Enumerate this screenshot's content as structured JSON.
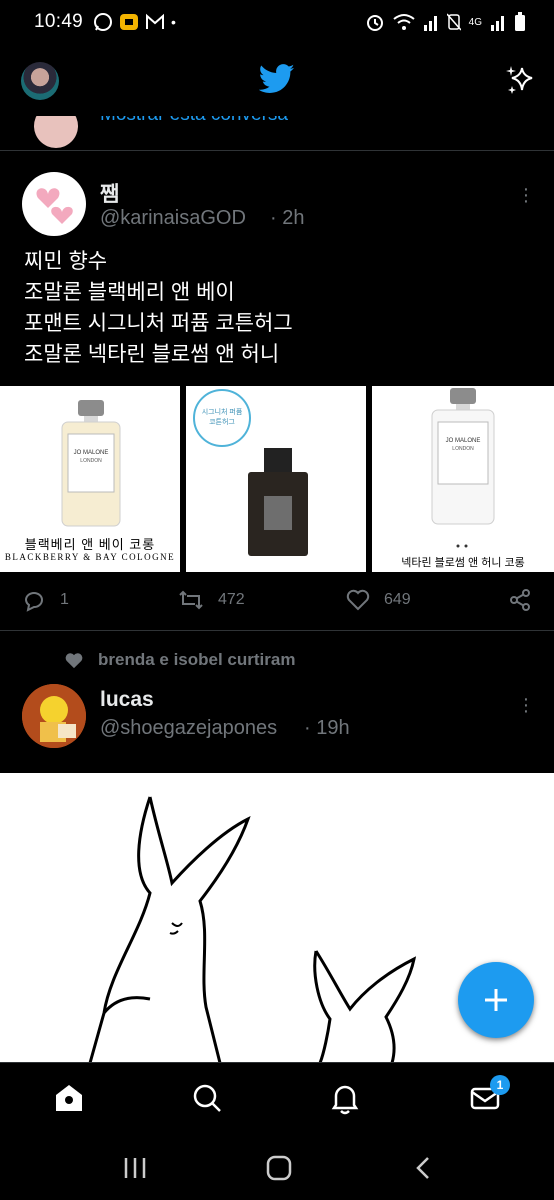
{
  "status_bar": {
    "time": "10:49",
    "network": "4G"
  },
  "header": {
    "logo_icon": "twitter-bird-icon",
    "sparkle_icon": "sparkle-icon"
  },
  "previous_tweet": {
    "link_text": "Mostrar esta conversa"
  },
  "tweet1": {
    "name": "쨈",
    "handle": "@karinaisaGOD",
    "time": "· 2h",
    "text": "찌민 향수\n조말론 블랙베리 앤 베이\n포맨트 시그니처 퍼퓸 코튼허그\n조말론 넥타린 블로썸 앤 허니",
    "images": [
      {
        "caption_ko": "블랙베리 앤 베이 코롱",
        "caption_en": "BLACKBERRY & BAY COLOGNE",
        "label": "JO MALONE",
        "sublabel": "LONDON"
      },
      {
        "badge": "시그니처 퍼퓸 코튼허그"
      },
      {
        "caption_ko": "넥타린 블로썸 앤 허니 코롱",
        "label": "JO MALONE",
        "sublabel": "LONDON"
      }
    ],
    "replies": "1",
    "retweets": "472",
    "likes": "649"
  },
  "tweet2": {
    "social_context": "brenda e isobel curtiram",
    "name": "lucas",
    "handle": "@shoegazejapones",
    "time": "· 19h"
  },
  "bottom_nav": {
    "messages_badge": "1"
  },
  "colors": {
    "accent": "#1d9bf0",
    "background": "#000000",
    "secondary_text": "#71767b"
  }
}
